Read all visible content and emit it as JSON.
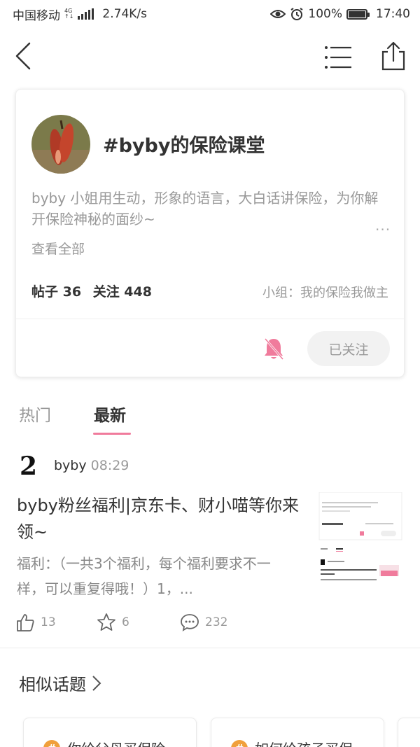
{
  "status_bar": {
    "carrier": "中国移动",
    "network_top": "4G",
    "network_bottom": "↑↓",
    "speed": "2.74K/s",
    "battery": "100%",
    "time": "17:40"
  },
  "topic": {
    "title": "#byby的保险课堂",
    "description": "byby 小姐用生动，形象的语言，大白话讲保险，为你解开保险神秘的面纱~",
    "more": "...",
    "view_all": "查看全部",
    "posts_stat": "帖子 36",
    "followers_stat": "关注 448",
    "group": "小组：我的保险我做主",
    "follow_button": "已关注"
  },
  "tabs": {
    "hot": "热门",
    "new": "最新"
  },
  "post": {
    "author_avatar": "2",
    "author": "byby",
    "time": "08:29",
    "title": "byby粉丝福利|京东卡、财小喵等你来领~",
    "body": "福利：（一共3个福利，每个福利要求不一样，可以重复得哦！）1，...",
    "likes": "13",
    "favorites": "6",
    "comments": "232"
  },
  "similar": {
    "title": "相似话题",
    "items": [
      {
        "badge": "#",
        "label": "你给父母买保险"
      },
      {
        "badge": "#",
        "label": "如何给孩子买保"
      }
    ]
  },
  "colors": {
    "accent": "#f07b9c",
    "badge": "#f0a03c"
  }
}
